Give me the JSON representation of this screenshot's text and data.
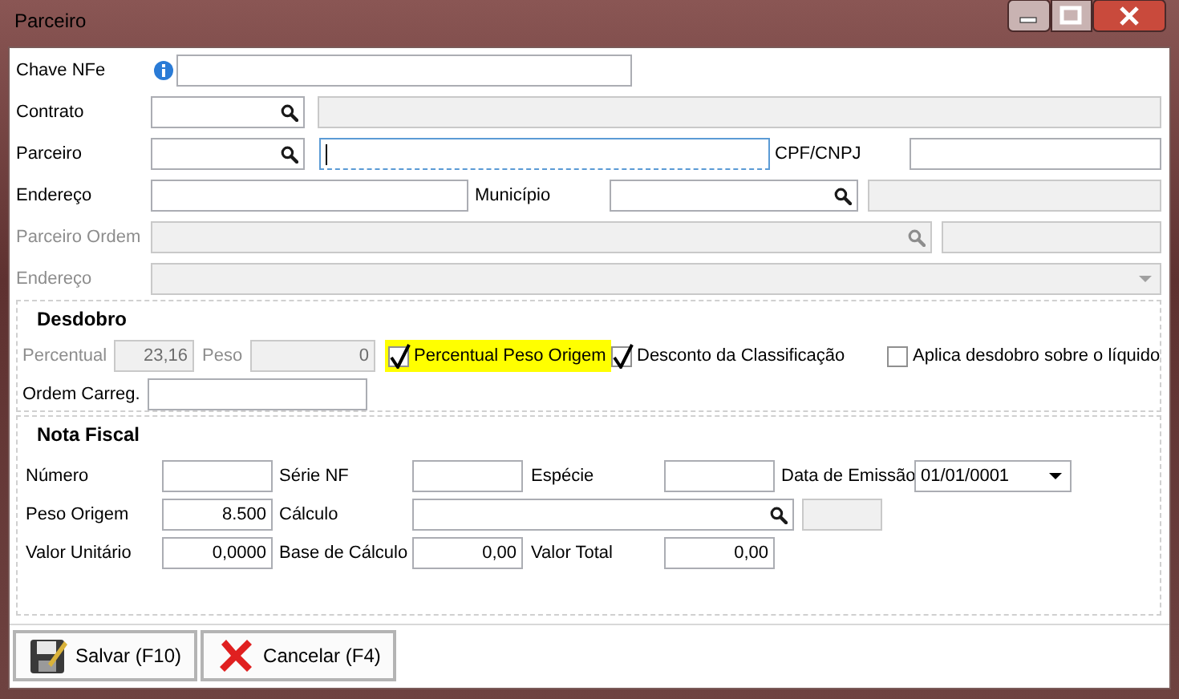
{
  "window": {
    "title": "Parceiro"
  },
  "top_rows": [
    {
      "items": [
        {
          "kind": "label",
          "text": "Chave NFe",
          "disabled": false
        },
        {
          "kind": "info"
        },
        {
          "kind": "text",
          "disabled": false,
          "focused": false
        }
      ]
    },
    {
      "items": [
        {
          "kind": "label",
          "text": "Contrato",
          "disabled": false
        },
        {
          "kind": "lookup",
          "disabled": false
        },
        {
          "kind": "readonly"
        }
      ]
    },
    {
      "items": [
        {
          "kind": "label",
          "text": "Parceiro",
          "disabled": false
        },
        {
          "kind": "lookup",
          "disabled": false
        },
        {
          "kind": "text",
          "disabled": false,
          "focused": true
        },
        {
          "kind": "label",
          "text": "CPF/CNPJ",
          "disabled": false
        },
        {
          "kind": "text",
          "disabled": false,
          "focused": false
        }
      ]
    },
    {
      "items": [
        {
          "kind": "label",
          "text": "Endereço",
          "disabled": false
        },
        {
          "kind": "text",
          "disabled": false,
          "focused": false
        },
        {
          "kind": "label",
          "text": "Município",
          "disabled": false
        },
        {
          "kind": "lookup",
          "disabled": false
        },
        {
          "kind": "readonly"
        }
      ]
    },
    {
      "items": [
        {
          "kind": "label",
          "text": "Parceiro Ordem",
          "disabled": true
        },
        {
          "kind": "lookup",
          "disabled": true
        },
        {
          "kind": "readonly"
        }
      ]
    },
    {
      "items": [
        {
          "kind": "label",
          "text": "Endereço",
          "disabled": true
        },
        {
          "kind": "combo",
          "disabled": true
        }
      ]
    }
  ],
  "desdobro": {
    "title": "Desdobro",
    "rows": [
      {
        "items": [
          {
            "kind": "label",
            "text": "Percentual",
            "disabled": true
          },
          {
            "kind": "text",
            "value": "23,16",
            "disabled": true,
            "focused": false
          },
          {
            "kind": "label",
            "text": "Peso",
            "disabled": true
          },
          {
            "kind": "text",
            "value": "0",
            "disabled": true,
            "focused": false
          },
          {
            "kind": "check",
            "text": "Percentual Peso Origem",
            "checked": true,
            "highlighted": true
          },
          {
            "kind": "check",
            "text": "Desconto da Classificação",
            "checked": true,
            "highlighted": false
          },
          {
            "kind": "check",
            "text": "Aplica desdobro sobre o líquido",
            "checked": false,
            "highlighted": false
          }
        ]
      },
      {
        "items": [
          {
            "kind": "label",
            "text": "Ordem Carreg.",
            "disabled": false
          },
          {
            "kind": "text",
            "disabled": false,
            "focused": false
          }
        ]
      }
    ]
  },
  "nota_fiscal": {
    "title": "Nota Fiscal",
    "rows": [
      {
        "items": [
          {
            "kind": "label",
            "text": "Número",
            "disabled": false
          },
          {
            "kind": "text",
            "disabled": false,
            "focused": false
          },
          {
            "kind": "label",
            "text": "Série NF",
            "disabled": false
          },
          {
            "kind": "text",
            "disabled": false,
            "focused": false
          },
          {
            "kind": "label",
            "text": "Espécie",
            "disabled": false
          },
          {
            "kind": "text",
            "disabled": false,
            "focused": false
          },
          {
            "kind": "label",
            "text": "Data de Emissão",
            "disabled": false
          },
          {
            "kind": "combo",
            "value": "01/01/0001",
            "disabled": false
          }
        ]
      },
      {
        "items": [
          {
            "kind": "label",
            "text": "Peso Origem",
            "disabled": false
          },
          {
            "kind": "text",
            "value": "8.500",
            "disabled": false,
            "focused": false
          },
          {
            "kind": "label",
            "text": "Cálculo",
            "disabled": false
          },
          {
            "kind": "lookup",
            "disabled": false
          },
          {
            "kind": "readonly"
          }
        ]
      },
      {
        "items": [
          {
            "kind": "label",
            "text": "Valor Unitário",
            "disabled": false
          },
          {
            "kind": "text",
            "value": "0,0000",
            "disabled": false,
            "focused": false
          },
          {
            "kind": "label",
            "text": "Base de Cálculo",
            "disabled": false
          },
          {
            "kind": "text",
            "value": "0,00",
            "disabled": false,
            "focused": false
          },
          {
            "kind": "label",
            "text": "Valor Total",
            "disabled": false
          },
          {
            "kind": "text",
            "value": "0,00",
            "disabled": false,
            "focused": false
          }
        ]
      }
    ]
  },
  "buttons": [
    {
      "kind": "save",
      "label": "Salvar (F10)"
    },
    {
      "kind": "cancel",
      "label": "Cancelar (F4)"
    }
  ]
}
